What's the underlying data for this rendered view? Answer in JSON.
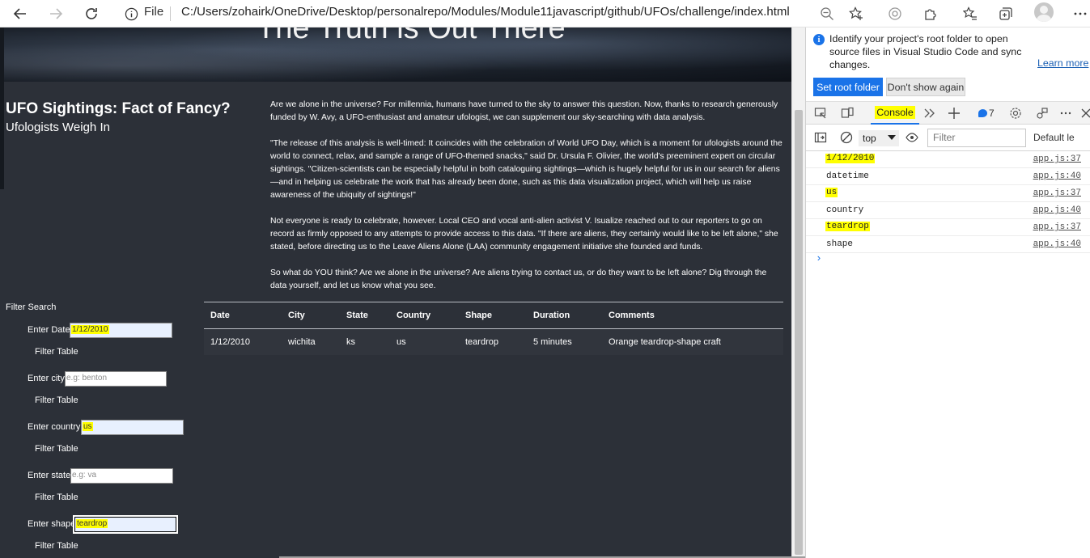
{
  "browser": {
    "protocol_label": "File",
    "url": "C:/Users/zohairk/OneDrive/Desktop/personalrepo/Modules/Module11javascript/github/UFOs/challenge/index.html"
  },
  "hero": {
    "title": "The Truth is Out There"
  },
  "header": {
    "title": "UFO Sightings: Fact of Fancy?",
    "subtitle": "Ufologists Weigh In"
  },
  "article": {
    "paragraphs": [
      "Are we alone in the universe? For millennia, humans have turned to the sky to answer this question. Now, thanks to research generously funded by W. Avy, a UFO-enthusiast and amateur ufologist, we can supplement our sky-searching with data analysis.",
      "\"The release of this analysis is well-timed: It coincides with the celebration of World UFO Day, which is a moment for ufologists around the world to connect, relax, and sample a range of UFO-themed snacks,\" said Dr. Ursula F. Olivier, the world's preeminent expert on circular sightings. \"Citizen-scientists can be especially helpful in both cataloguing sightings—which is hugely helpful for us in our search for aliens—and in helping us celebrate the work that has already been done, such as this data visualization project, which will help us raise awareness of the ubiquity of sightings!\"",
      "Not everyone is ready to celebrate, however. Local CEO and vocal anti-alien activist V. Isualize reached out to our reporters to go on record as firmly opposed to any attempts to provide access to this data. \"If there are aliens, they certainly would like to be left alone,\" she stated, before directing us to the Leave Aliens Alone (LAA) community engagement initiative she founded and funds.",
      "So what do YOU think? Are we alone in the universe? Are aliens trying to contact us, or do they want to be left alone? Dig through the data yourself, and let us know what you see."
    ]
  },
  "filters": {
    "heading": "Filter Search",
    "button_label": "Filter Table",
    "date": {
      "label": "Enter Date",
      "value": "1/12/2010",
      "placeholder": ""
    },
    "city": {
      "label": "Enter city",
      "value": "",
      "placeholder": "e.g: benton"
    },
    "country": {
      "label": "Enter country",
      "value": "us",
      "placeholder": ""
    },
    "state": {
      "label": "Enter state",
      "value": "",
      "placeholder": "e.g: va"
    },
    "shape": {
      "label": "Enter shape",
      "value": "teardrop",
      "placeholder": ""
    }
  },
  "table": {
    "headers": [
      "Date",
      "City",
      "State",
      "Country",
      "Shape",
      "Duration",
      "Comments"
    ],
    "rows": [
      [
        "1/12/2010",
        "wichita",
        "ks",
        "us",
        "teardrop",
        "5 minutes",
        "Orange teardrop-shape craft"
      ]
    ]
  },
  "devtools": {
    "info": {
      "text": "Identify your project's root folder to open source files in Visual Studio Code and sync changes.",
      "learn_more": "Learn more",
      "set_root": "Set root folder",
      "dont_show": "Don't show again"
    },
    "console_tab": "Console",
    "issues_count": "7",
    "context": "top",
    "filter_placeholder": "Filter",
    "level": "Default le",
    "logs": [
      {
        "msg": "1/12/2010",
        "src": "app.js:37",
        "highlight": true
      },
      {
        "msg": "datetime",
        "src": "app.js:40",
        "highlight": false
      },
      {
        "msg": "us",
        "src": "app.js:37",
        "highlight": true
      },
      {
        "msg": "country",
        "src": "app.js:40",
        "highlight": false
      },
      {
        "msg": "teardrop",
        "src": "app.js:37",
        "highlight": true
      },
      {
        "msg": "shape",
        "src": "app.js:40",
        "highlight": false
      }
    ],
    "prompt": "›"
  },
  "colors": {
    "page_bg": "#2c3038",
    "highlight": "#ffff00",
    "accent": "#1a73e8"
  }
}
